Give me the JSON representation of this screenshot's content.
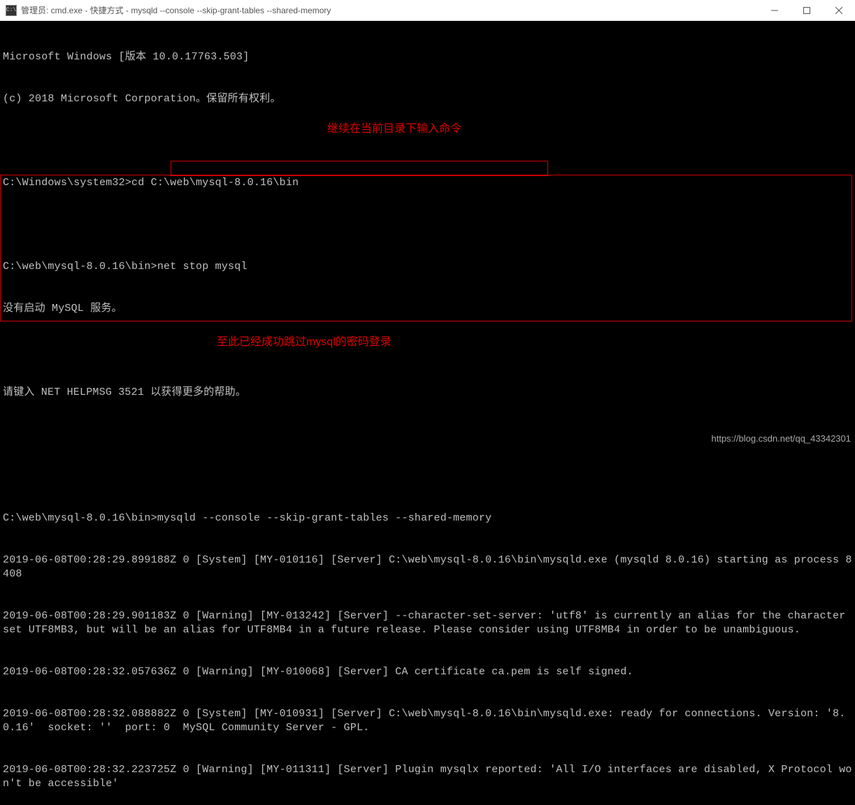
{
  "titlebar": {
    "icon_text": "C:\\",
    "title": "管理员: cmd.exe - 快捷方式 - mysqld  --console --skip-grant-tables --shared-memory"
  },
  "terminal": {
    "l1": "Microsoft Windows [版本 10.0.17763.503]",
    "l2": "(c) 2018 Microsoft Corporation。保留所有权利。",
    "l3": "",
    "l4": "C:\\Windows\\system32>cd C:\\web\\mysql-8.0.16\\bin",
    "l5": "",
    "l6": "C:\\web\\mysql-8.0.16\\bin>net stop mysql",
    "l7": "没有启动 MySQL 服务。",
    "l8": "",
    "l9": "请键入 NET HELPMSG 3521 以获得更多的帮助。",
    "l10": "",
    "l11": "",
    "l12": "C:\\web\\mysql-8.0.16\\bin>mysqld --console --skip-grant-tables --shared-memory",
    "l13": "2019-06-08T00:28:29.899188Z 0 [System] [MY-010116] [Server] C:\\web\\mysql-8.0.16\\bin\\mysqld.exe (mysqld 8.0.16) starting as process 8408",
    "l14": "2019-06-08T00:28:29.901183Z 0 [Warning] [MY-013242] [Server] --character-set-server: 'utf8' is currently an alias for the character set UTF8MB3, but will be an alias for UTF8MB4 in a future release. Please consider using UTF8MB4 in order to be unambiguous.",
    "l15": "2019-06-08T00:28:32.057636Z 0 [Warning] [MY-010068] [Server] CA certificate ca.pem is self signed.",
    "l16": "2019-06-08T00:28:32.088882Z 0 [System] [MY-010931] [Server] C:\\web\\mysql-8.0.16\\bin\\mysqld.exe: ready for connections. Version: '8.0.16'  socket: ''  port: 0  MySQL Community Server - GPL.",
    "l17": "2019-06-08T00:28:32.223725Z 0 [Warning] [MY-011311] [Server] Plugin mysqlx reported: 'All I/O interfaces are disabled, X Protocol won't be accessible'"
  },
  "annotations": {
    "a1": "继续在当前目录下输入命令",
    "a2": "至此已经成功跳过mysql的密码登录"
  },
  "watermark": "https://blog.csdn.net/qq_43342301"
}
